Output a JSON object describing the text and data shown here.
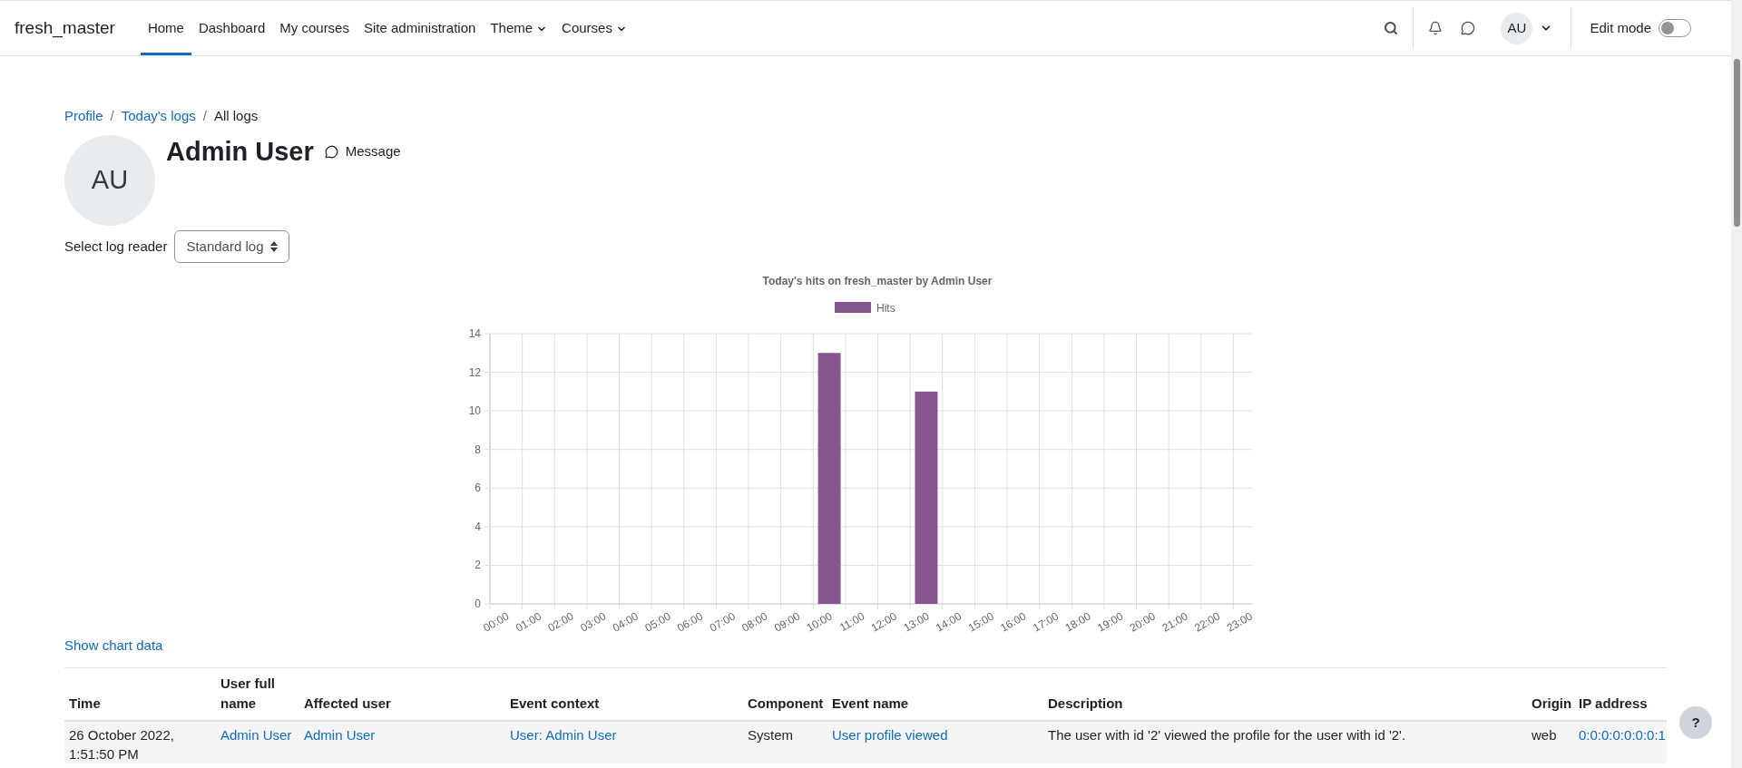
{
  "site_name": "fresh_master",
  "nav": [
    {
      "label": "Home",
      "selected": true,
      "kind": "link"
    },
    {
      "label": "Dashboard",
      "selected": false,
      "kind": "link"
    },
    {
      "label": "My courses",
      "selected": false,
      "kind": "link"
    },
    {
      "label": "Site administration",
      "selected": false,
      "kind": "link"
    },
    {
      "label": "Theme",
      "selected": false,
      "kind": "dropdown"
    },
    {
      "label": "Courses",
      "selected": false,
      "kind": "dropdown"
    }
  ],
  "user_menu": {
    "initials": "AU"
  },
  "edit_mode": {
    "label": "Edit mode",
    "on": false
  },
  "breadcrumb_separator": "/",
  "breadcrumb": [
    {
      "label": "Profile",
      "kind": "link"
    },
    {
      "label": "Today's logs",
      "kind": "link"
    },
    {
      "label": "All logs",
      "kind": "current"
    }
  ],
  "profile": {
    "initials": "AU",
    "name": "Admin User",
    "message": "Message"
  },
  "log_reader": {
    "label": "Select log reader",
    "value": "Standard log"
  },
  "chart": {
    "chart_data": {
      "type": "bar",
      "title": "Today's hits on fresh_master by Admin User",
      "categories": [
        "00:00",
        "01:00",
        "02:00",
        "03:00",
        "04:00",
        "05:00",
        "06:00",
        "07:00",
        "08:00",
        "09:00",
        "10:00",
        "11:00",
        "12:00",
        "13:00",
        "14:00",
        "15:00",
        "16:00",
        "17:00",
        "18:00",
        "19:00",
        "20:00",
        "21:00",
        "22:00",
        "23:00"
      ],
      "series": [
        {
          "name": "Hits",
          "color": "#86548f",
          "values": [
            0,
            0,
            0,
            0,
            0,
            0,
            0,
            0,
            0,
            0,
            13,
            0,
            0,
            11,
            0,
            0,
            0,
            0,
            0,
            0,
            0,
            0,
            0,
            0
          ]
        }
      ],
      "grid": true,
      "ylim": [
        0,
        14
      ],
      "yticks": [
        0,
        2,
        4,
        6,
        8,
        10,
        12,
        14
      ]
    }
  },
  "show_chart_data": "Show chart data",
  "table": {
    "columns": [
      "Time",
      "User full name",
      "Affected user",
      "Event context",
      "Component",
      "Event name",
      "Description",
      "Origin",
      "IP address"
    ],
    "rows": [
      [
        {
          "text": "26 October 2022, 1:51:50 PM",
          "kind": "text"
        },
        {
          "text": "Admin User",
          "kind": "link"
        },
        {
          "text": "Admin User",
          "kind": "link"
        },
        {
          "text": "User: Admin User",
          "kind": "link"
        },
        {
          "text": "System",
          "kind": "text"
        },
        {
          "text": "User profile viewed",
          "kind": "link"
        },
        {
          "text": "The user with id '2' viewed the profile for the user with id '2'.",
          "kind": "text"
        },
        {
          "text": "web",
          "kind": "text"
        },
        {
          "text": "0:0:0:0:0:0:0:1",
          "kind": "link"
        }
      ]
    ]
  },
  "help": "?"
}
